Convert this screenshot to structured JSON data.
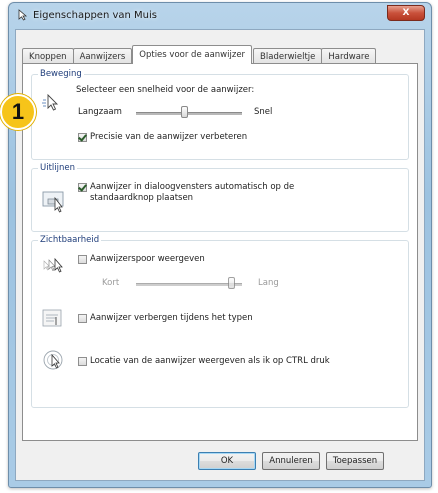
{
  "window": {
    "title": "Eigenschappen van Muis",
    "close_label": "X"
  },
  "tabs": [
    {
      "label": "Knoppen",
      "active": false
    },
    {
      "label": "Aanwijzers",
      "active": false
    },
    {
      "label": "Opties voor de aanwijzer",
      "active": true
    },
    {
      "label": "Bladerwieltje",
      "active": false
    },
    {
      "label": "Hardware",
      "active": false
    }
  ],
  "badge": {
    "number": "1"
  },
  "motion": {
    "title": "Beweging",
    "description": "Selecteer een snelheid voor de aanwijzer:",
    "slow_label": "Langzaam",
    "fast_label": "Snel",
    "speed_level": 0.45,
    "precision_label": "Precisie van de aanwijzer verbeteren",
    "precision_checked": true
  },
  "snap": {
    "title": "Uitlijnen",
    "label_line1": "Aanwijzer in dialoogvensters automatisch op de",
    "label_line2": "standaardknop plaatsen",
    "checked": true
  },
  "visibility": {
    "title": "Zichtbaarheid",
    "trails_label": "Aanwijzerspoor weergeven",
    "trails_checked": false,
    "short_label": "Kort",
    "long_label": "Lang",
    "trail_level": 0.9,
    "hide_label": "Aanwijzer verbergen tijdens het typen",
    "hide_checked": false,
    "ctrl_label": "Locatie van de aanwijzer weergeven als ik op CTRL druk",
    "ctrl_checked": false
  },
  "buttons": {
    "ok": "OK",
    "cancel": "Annuleren",
    "apply": "Toepassen"
  },
  "icons": {
    "title": "mouse-icon",
    "motion": "pointer-speed-icon",
    "snap": "snap-to-default-icon",
    "trails": "pointer-trails-icon",
    "hide": "hide-pointer-icon",
    "ctrl": "locate-pointer-icon"
  }
}
